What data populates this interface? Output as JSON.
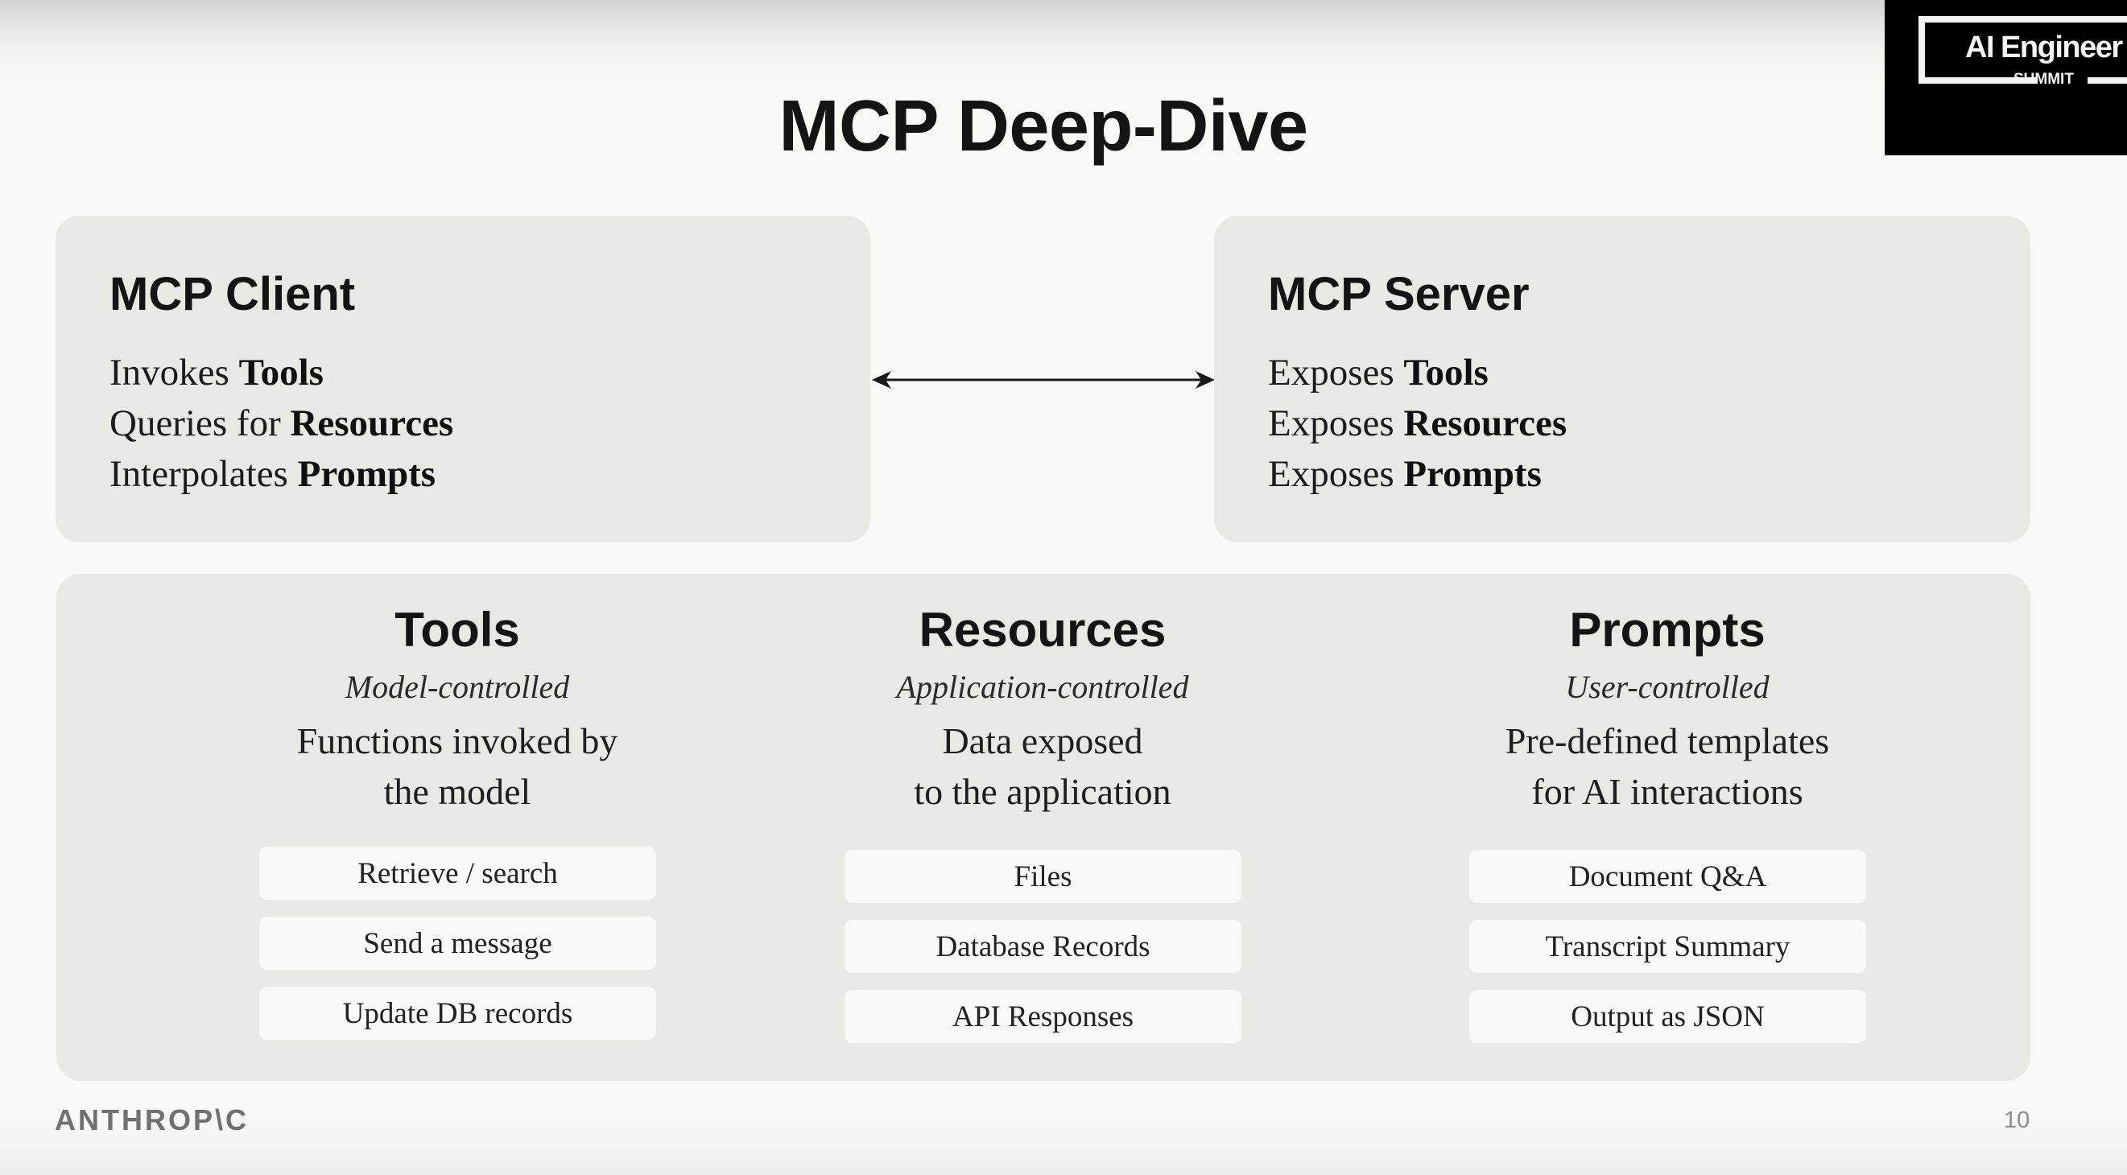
{
  "slide": {
    "title": "MCP Deep-Dive",
    "page_number": "10"
  },
  "event_logo": {
    "name": "AI Engineer",
    "subtitle": "SUMMIT"
  },
  "brand": {
    "name": "ANTHROP\\C"
  },
  "client": {
    "heading": "MCP Client",
    "lines": [
      {
        "verb": "Invokes",
        "object": "Tools"
      },
      {
        "verb": "Queries for",
        "object": "Resources"
      },
      {
        "verb": "Interpolates",
        "object": "Prompts"
      }
    ]
  },
  "connector": {
    "icon": "double-headed-arrow-icon",
    "color": "#1a1a1a"
  },
  "server": {
    "heading": "MCP Server",
    "lines": [
      {
        "verb": "Exposes",
        "object": "Tools"
      },
      {
        "verb": "Exposes",
        "object": "Resources"
      },
      {
        "verb": "Exposes",
        "object": "Prompts"
      }
    ]
  },
  "primitives": [
    {
      "heading": "Tools",
      "control": "Model-controlled",
      "description": [
        "Functions invoked by",
        "the model"
      ],
      "examples": [
        "Retrieve / search",
        "Send a message",
        "Update DB records"
      ]
    },
    {
      "heading": "Resources",
      "control": "Application-controlled",
      "description": [
        "Data exposed",
        "to the application"
      ],
      "examples": [
        "Files",
        "Database Records",
        "API Responses"
      ]
    },
    {
      "heading": "Prompts",
      "control": "User-controlled",
      "description": [
        "Pre-defined templates",
        "for AI interactions"
      ],
      "examples": [
        "Document Q&A",
        "Transcript Summary",
        "Output as JSON"
      ]
    }
  ],
  "colors": {
    "background": "#f9f9f7",
    "card": "#e8e8e4",
    "pill": "#f9f9f7",
    "text": "#141414",
    "footer_text": "#707070"
  }
}
